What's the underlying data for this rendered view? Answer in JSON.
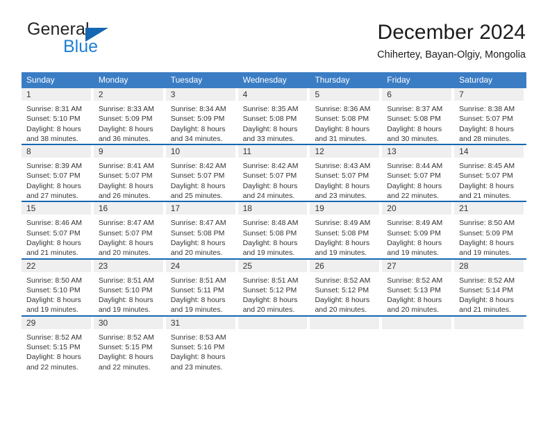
{
  "brand": {
    "name_part1": "General",
    "name_part2": "Blue",
    "triangle_color": "#1567b2",
    "blue_color": "#1d7fd4"
  },
  "header": {
    "title": "December 2024",
    "subtitle": "Chihertey, Bayan-Olgiy, Mongolia"
  },
  "theme": {
    "header_bar_color": "#3b7dc4",
    "row_divider_color": "#1567b2",
    "day_strip_color": "#efefef",
    "text_color": "#333333"
  },
  "weekdays": [
    "Sunday",
    "Monday",
    "Tuesday",
    "Wednesday",
    "Thursday",
    "Friday",
    "Saturday"
  ],
  "weeks": [
    [
      {
        "day": "1",
        "sunrise": "Sunrise: 8:31 AM",
        "sunset": "Sunset: 5:10 PM",
        "daylight_1": "Daylight: 8 hours",
        "daylight_2": "and 38 minutes."
      },
      {
        "day": "2",
        "sunrise": "Sunrise: 8:33 AM",
        "sunset": "Sunset: 5:09 PM",
        "daylight_1": "Daylight: 8 hours",
        "daylight_2": "and 36 minutes."
      },
      {
        "day": "3",
        "sunrise": "Sunrise: 8:34 AM",
        "sunset": "Sunset: 5:09 PM",
        "daylight_1": "Daylight: 8 hours",
        "daylight_2": "and 34 minutes."
      },
      {
        "day": "4",
        "sunrise": "Sunrise: 8:35 AM",
        "sunset": "Sunset: 5:08 PM",
        "daylight_1": "Daylight: 8 hours",
        "daylight_2": "and 33 minutes."
      },
      {
        "day": "5",
        "sunrise": "Sunrise: 8:36 AM",
        "sunset": "Sunset: 5:08 PM",
        "daylight_1": "Daylight: 8 hours",
        "daylight_2": "and 31 minutes."
      },
      {
        "day": "6",
        "sunrise": "Sunrise: 8:37 AM",
        "sunset": "Sunset: 5:08 PM",
        "daylight_1": "Daylight: 8 hours",
        "daylight_2": "and 30 minutes."
      },
      {
        "day": "7",
        "sunrise": "Sunrise: 8:38 AM",
        "sunset": "Sunset: 5:07 PM",
        "daylight_1": "Daylight: 8 hours",
        "daylight_2": "and 28 minutes."
      }
    ],
    [
      {
        "day": "8",
        "sunrise": "Sunrise: 8:39 AM",
        "sunset": "Sunset: 5:07 PM",
        "daylight_1": "Daylight: 8 hours",
        "daylight_2": "and 27 minutes."
      },
      {
        "day": "9",
        "sunrise": "Sunrise: 8:41 AM",
        "sunset": "Sunset: 5:07 PM",
        "daylight_1": "Daylight: 8 hours",
        "daylight_2": "and 26 minutes."
      },
      {
        "day": "10",
        "sunrise": "Sunrise: 8:42 AM",
        "sunset": "Sunset: 5:07 PM",
        "daylight_1": "Daylight: 8 hours",
        "daylight_2": "and 25 minutes."
      },
      {
        "day": "11",
        "sunrise": "Sunrise: 8:42 AM",
        "sunset": "Sunset: 5:07 PM",
        "daylight_1": "Daylight: 8 hours",
        "daylight_2": "and 24 minutes."
      },
      {
        "day": "12",
        "sunrise": "Sunrise: 8:43 AM",
        "sunset": "Sunset: 5:07 PM",
        "daylight_1": "Daylight: 8 hours",
        "daylight_2": "and 23 minutes."
      },
      {
        "day": "13",
        "sunrise": "Sunrise: 8:44 AM",
        "sunset": "Sunset: 5:07 PM",
        "daylight_1": "Daylight: 8 hours",
        "daylight_2": "and 22 minutes."
      },
      {
        "day": "14",
        "sunrise": "Sunrise: 8:45 AM",
        "sunset": "Sunset: 5:07 PM",
        "daylight_1": "Daylight: 8 hours",
        "daylight_2": "and 21 minutes."
      }
    ],
    [
      {
        "day": "15",
        "sunrise": "Sunrise: 8:46 AM",
        "sunset": "Sunset: 5:07 PM",
        "daylight_1": "Daylight: 8 hours",
        "daylight_2": "and 21 minutes."
      },
      {
        "day": "16",
        "sunrise": "Sunrise: 8:47 AM",
        "sunset": "Sunset: 5:07 PM",
        "daylight_1": "Daylight: 8 hours",
        "daylight_2": "and 20 minutes."
      },
      {
        "day": "17",
        "sunrise": "Sunrise: 8:47 AM",
        "sunset": "Sunset: 5:08 PM",
        "daylight_1": "Daylight: 8 hours",
        "daylight_2": "and 20 minutes."
      },
      {
        "day": "18",
        "sunrise": "Sunrise: 8:48 AM",
        "sunset": "Sunset: 5:08 PM",
        "daylight_1": "Daylight: 8 hours",
        "daylight_2": "and 19 minutes."
      },
      {
        "day": "19",
        "sunrise": "Sunrise: 8:49 AM",
        "sunset": "Sunset: 5:08 PM",
        "daylight_1": "Daylight: 8 hours",
        "daylight_2": "and 19 minutes."
      },
      {
        "day": "20",
        "sunrise": "Sunrise: 8:49 AM",
        "sunset": "Sunset: 5:09 PM",
        "daylight_1": "Daylight: 8 hours",
        "daylight_2": "and 19 minutes."
      },
      {
        "day": "21",
        "sunrise": "Sunrise: 8:50 AM",
        "sunset": "Sunset: 5:09 PM",
        "daylight_1": "Daylight: 8 hours",
        "daylight_2": "and 19 minutes."
      }
    ],
    [
      {
        "day": "22",
        "sunrise": "Sunrise: 8:50 AM",
        "sunset": "Sunset: 5:10 PM",
        "daylight_1": "Daylight: 8 hours",
        "daylight_2": "and 19 minutes."
      },
      {
        "day": "23",
        "sunrise": "Sunrise: 8:51 AM",
        "sunset": "Sunset: 5:10 PM",
        "daylight_1": "Daylight: 8 hours",
        "daylight_2": "and 19 minutes."
      },
      {
        "day": "24",
        "sunrise": "Sunrise: 8:51 AM",
        "sunset": "Sunset: 5:11 PM",
        "daylight_1": "Daylight: 8 hours",
        "daylight_2": "and 19 minutes."
      },
      {
        "day": "25",
        "sunrise": "Sunrise: 8:51 AM",
        "sunset": "Sunset: 5:12 PM",
        "daylight_1": "Daylight: 8 hours",
        "daylight_2": "and 20 minutes."
      },
      {
        "day": "26",
        "sunrise": "Sunrise: 8:52 AM",
        "sunset": "Sunset: 5:12 PM",
        "daylight_1": "Daylight: 8 hours",
        "daylight_2": "and 20 minutes."
      },
      {
        "day": "27",
        "sunrise": "Sunrise: 8:52 AM",
        "sunset": "Sunset: 5:13 PM",
        "daylight_1": "Daylight: 8 hours",
        "daylight_2": "and 20 minutes."
      },
      {
        "day": "28",
        "sunrise": "Sunrise: 8:52 AM",
        "sunset": "Sunset: 5:14 PM",
        "daylight_1": "Daylight: 8 hours",
        "daylight_2": "and 21 minutes."
      }
    ],
    [
      {
        "day": "29",
        "sunrise": "Sunrise: 8:52 AM",
        "sunset": "Sunset: 5:15 PM",
        "daylight_1": "Daylight: 8 hours",
        "daylight_2": "and 22 minutes."
      },
      {
        "day": "30",
        "sunrise": "Sunrise: 8:52 AM",
        "sunset": "Sunset: 5:15 PM",
        "daylight_1": "Daylight: 8 hours",
        "daylight_2": "and 22 minutes."
      },
      {
        "day": "31",
        "sunrise": "Sunrise: 8:53 AM",
        "sunset": "Sunset: 5:16 PM",
        "daylight_1": "Daylight: 8 hours",
        "daylight_2": "and 23 minutes."
      },
      {
        "day": "",
        "sunrise": "",
        "sunset": "",
        "daylight_1": "",
        "daylight_2": ""
      },
      {
        "day": "",
        "sunrise": "",
        "sunset": "",
        "daylight_1": "",
        "daylight_2": ""
      },
      {
        "day": "",
        "sunrise": "",
        "sunset": "",
        "daylight_1": "",
        "daylight_2": ""
      },
      {
        "day": "",
        "sunrise": "",
        "sunset": "",
        "daylight_1": "",
        "daylight_2": ""
      }
    ]
  ]
}
